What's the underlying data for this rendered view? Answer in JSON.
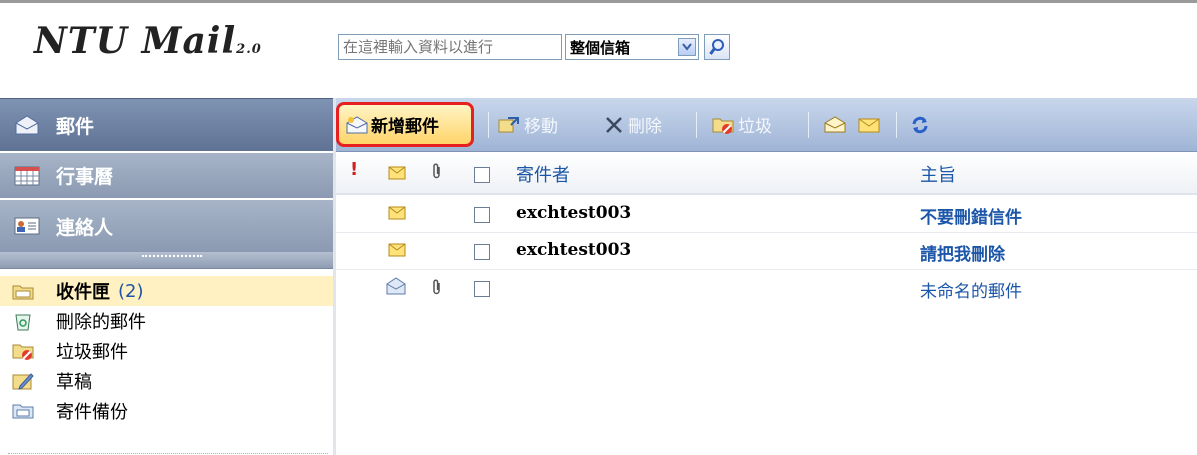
{
  "app": {
    "logo": "NTU Mail",
    "logo_version": "2.0"
  },
  "search": {
    "placeholder": "在這裡輸入資料以進行",
    "scope_value": "整個信箱"
  },
  "nav": {
    "mail": "郵件",
    "calendar": "行事曆",
    "contacts": "連絡人"
  },
  "folders": [
    {
      "name": "收件匣",
      "count": "(2)",
      "selected": true
    },
    {
      "name": "刪除的郵件"
    },
    {
      "name": "垃圾郵件"
    },
    {
      "name": "草稿"
    },
    {
      "name": "寄件備份"
    }
  ],
  "toolbar": {
    "new_mail": "新增郵件",
    "move": "移動",
    "delete": "刪除",
    "junk": "垃圾"
  },
  "columns": {
    "importance": "!",
    "from": "寄件者",
    "subject": "主旨"
  },
  "messages": [
    {
      "from": "exchtest003",
      "subject": "不要刪錯信件",
      "unread": true
    },
    {
      "from": "exchtest003",
      "subject": "請把我刪除",
      "unread": true
    },
    {
      "from": "",
      "subject": "未命名的郵件",
      "unread": false,
      "attachment": true
    }
  ],
  "colors": {
    "accent": "#1c56a8",
    "nav_active": "#6a7d9e",
    "selection": "#fff1c1",
    "highlight_border": "#e61f1f"
  }
}
